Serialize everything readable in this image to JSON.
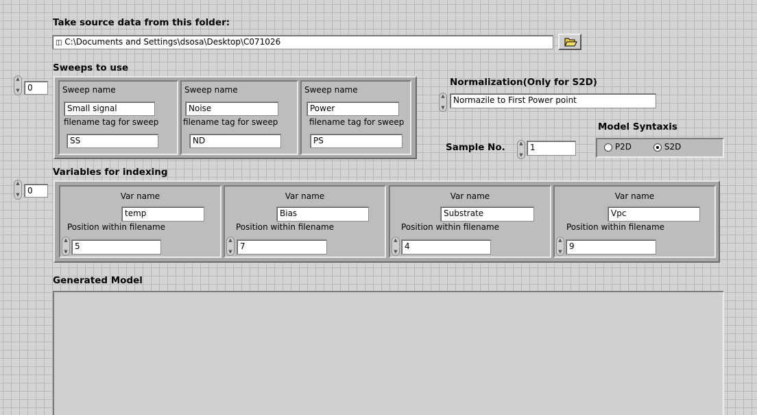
{
  "source": {
    "heading": "Take source data from this folder:",
    "path_prefix_icon": "path-symbol",
    "path": "C:\\Documents and Settings\\dsosa\\Desktop\\C071026",
    "browse_icon": "folder-open-icon"
  },
  "sweeps": {
    "heading": "Sweeps to use",
    "index": "0",
    "items": [
      {
        "name_label": "Sweep name",
        "name": "Small signal",
        "tag_label": "filename tag for sweep",
        "tag": "SS"
      },
      {
        "name_label": "Sweep name",
        "name": "Noise",
        "tag_label": "filename tag for sweep",
        "tag": "ND"
      },
      {
        "name_label": "Sweep name",
        "name": "Power",
        "tag_label": "filename tag for sweep",
        "tag": "PS"
      }
    ]
  },
  "normalization": {
    "heading": "Normalization(Only for S2D)",
    "value": "Normazile to First Power point"
  },
  "sample": {
    "label": "Sample No.",
    "value": "1"
  },
  "model_syntax": {
    "heading": "Model Syntaxis",
    "options": [
      {
        "label": "P2D",
        "selected": false
      },
      {
        "label": "S2D",
        "selected": true
      }
    ]
  },
  "variables": {
    "heading": "Variables for indexing",
    "index": "0",
    "items": [
      {
        "name_label": "Var name",
        "name": "temp",
        "pos_label": "Position within filename",
        "pos": "5"
      },
      {
        "name_label": "Var name",
        "name": "Bias",
        "pos_label": "Position within filename",
        "pos": "7"
      },
      {
        "name_label": "Var name",
        "name": "Substrate",
        "pos_label": "Position within filename",
        "pos": "4"
      },
      {
        "name_label": "Var name",
        "name": "Vpc",
        "pos_label": "Position within filename",
        "pos": "9"
      }
    ]
  },
  "generated": {
    "heading": "Generated Model",
    "content": ""
  }
}
